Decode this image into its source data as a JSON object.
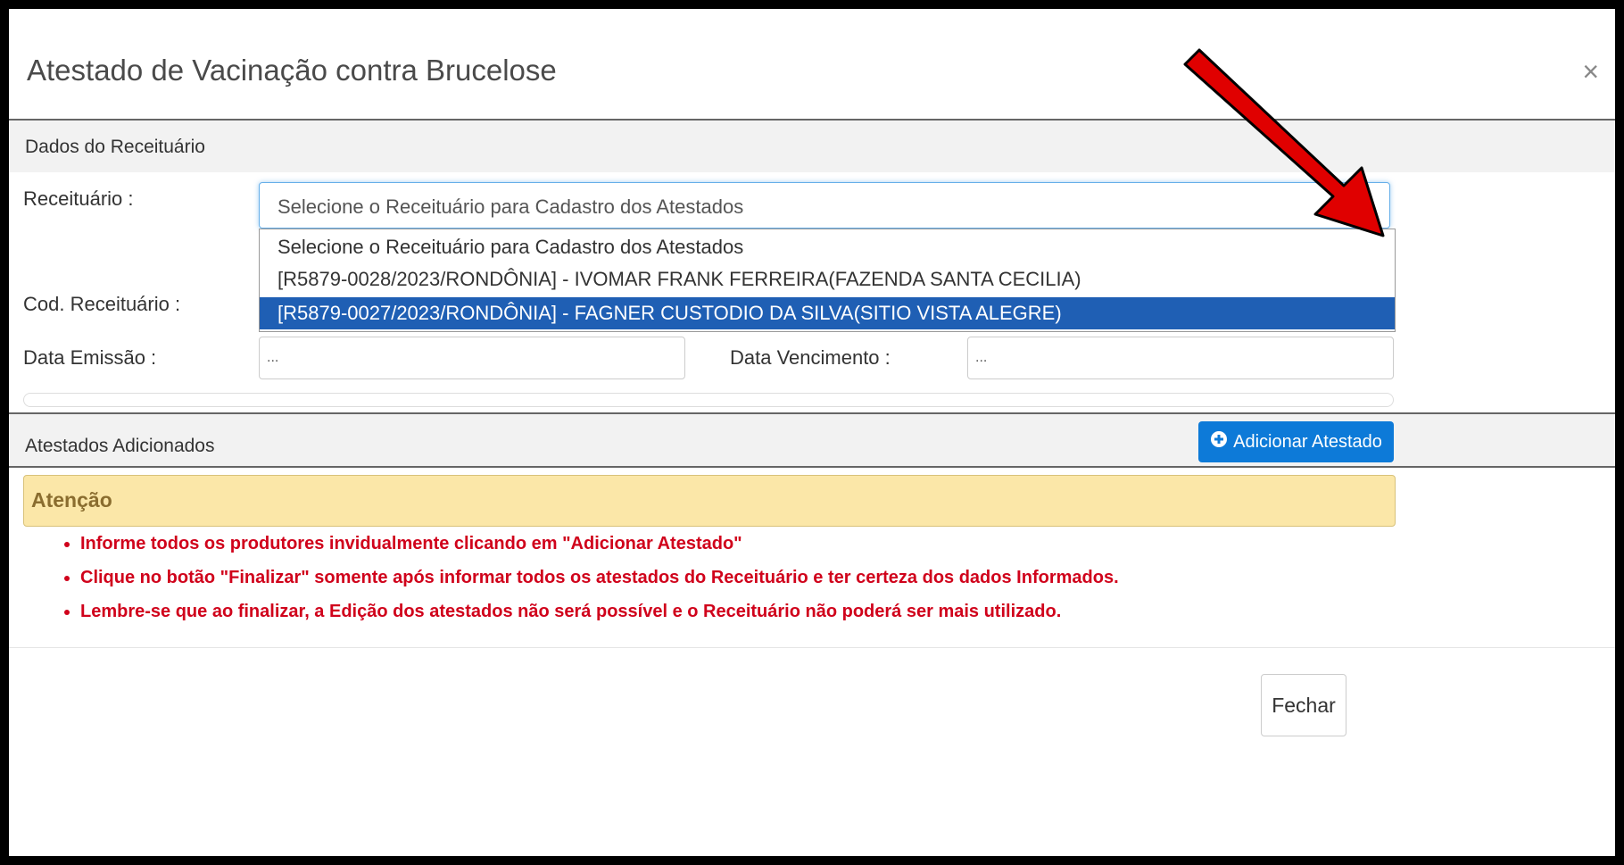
{
  "modal": {
    "title": "Atestado de Vacinação contra Brucelose",
    "close_glyph": "×"
  },
  "section_receituario": {
    "header": "Dados do Receituário",
    "receituario_label": "Receituário :",
    "select_value": "Selecione o Receituário para Cadastro dos Atestados",
    "options": [
      "Selecione o Receituário para Cadastro dos Atestados",
      "[R5879-0028/2023/RONDÔNIA] - IVOMAR FRANK FERREIRA(FAZENDA SANTA CECILIA)",
      "[R5879-0027/2023/RONDÔNIA] - FAGNER CUSTODIO DA SILVA(SITIO VISTA ALEGRE)"
    ],
    "highlighted_option_index": 2,
    "cod_label": "Cod. Receituário :",
    "data_emissao_label": "Data Emissão :",
    "data_emissao_value": "...",
    "data_vencimento_label": "Data Vencimento :",
    "data_vencimento_value": "..."
  },
  "section_atestados": {
    "header": "Atestados Adicionados",
    "add_button_label": "Adicionar Atestado"
  },
  "alert": {
    "title": "Atenção",
    "items": [
      "Informe todos os produtores invidualmente clicando em \"Adicionar Atestado\"",
      "Clique no botão \"Finalizar\" somente após informar todos os atestados do Receituário e ter certeza dos dados Informados.",
      "Lembre-se que ao finalizar, a Edição dos atestados não será possível e o Receituário não poderá ser mais utilizado."
    ]
  },
  "footer": {
    "close_button_label": "Fechar"
  },
  "colors": {
    "primary_button": "#0d7ad8",
    "highlight_option": "#1f5fb4",
    "alert_bg": "#fbe7a8",
    "alert_text": "#8a6d2f",
    "warning_text": "#d0021b",
    "annotation_arrow": "#e00000"
  },
  "icons": {
    "close": "close-icon",
    "dropdown": "chevron-down-icon",
    "add": "plus-circle-icon",
    "annotation": "red-arrow-icon"
  }
}
